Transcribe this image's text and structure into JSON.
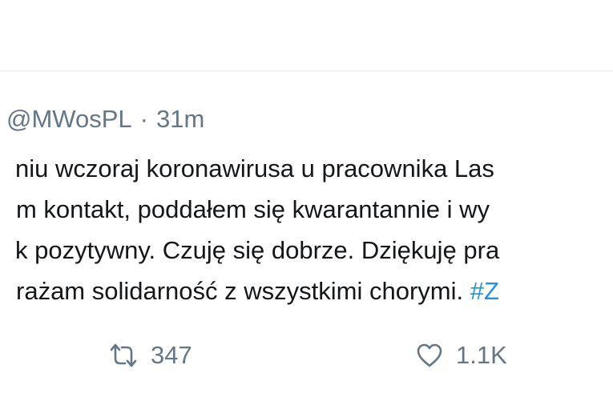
{
  "tweet": {
    "handle": "@MWosPL",
    "separator": "·",
    "time": "31m",
    "text_lines": [
      "niu wczoraj koronawirusa u pracownika Las",
      "m kontakt, poddałem się kwarantannie i wy",
      "k pozytywny. Czuję się dobrze. Dziękuję pra",
      "rażam solidarność z wszystkimi chorymi."
    ],
    "hashtag": "#Z"
  },
  "actions": {
    "retweet_icon": "retweet-icon",
    "retweet_count": "347",
    "like_icon": "heart-icon",
    "like_count": "1.1K"
  },
  "colors": {
    "text": "#14171a",
    "muted": "#657786",
    "link": "#1b95e0",
    "divider": "#e6ecf0"
  }
}
